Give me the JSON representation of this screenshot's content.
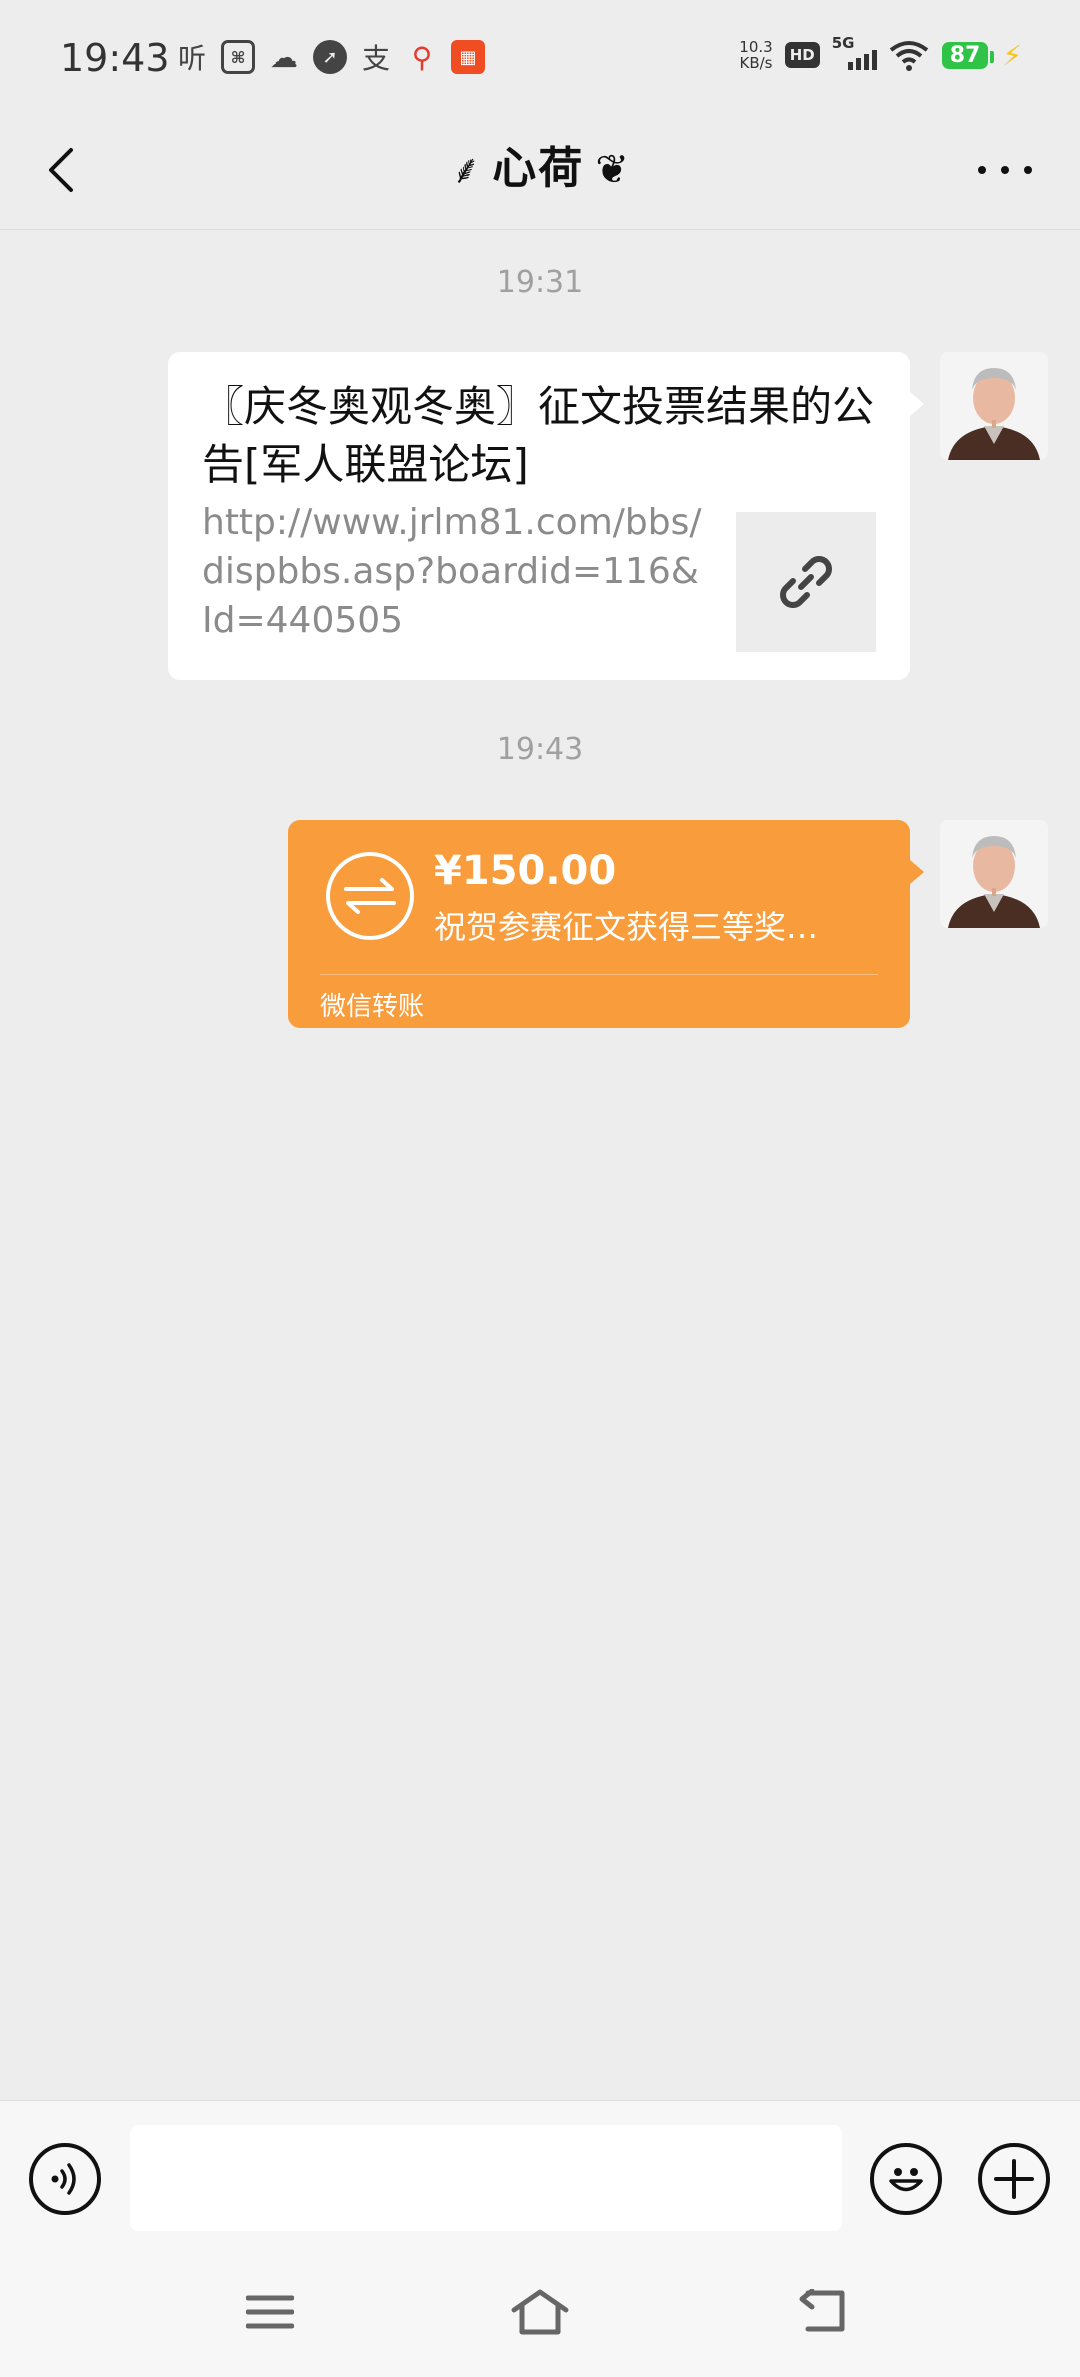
{
  "status_bar": {
    "time": "19:43",
    "net_speed_value": "10.3",
    "net_speed_unit": "KB/s",
    "hd_badge": "HD",
    "network": "5G",
    "battery": "87",
    "left_icons": [
      "listen-icon",
      "sb-app-icon",
      "cloud-icon",
      "compass-icon",
      "alipay-icon",
      "location-pin-icon",
      "app-grid-icon"
    ],
    "listen_glyph": "听",
    "alipay_glyph": "支"
  },
  "header": {
    "title": "心荷",
    "title_ornament_left": "⸙",
    "title_ornament_right": "❦",
    "back_icon": "chevron-left-icon",
    "more_icon": "more-dots-icon"
  },
  "chat": {
    "messages": [
      {
        "timestamp": "19:31",
        "type": "link",
        "title": "〖庆冬奥观冬奥〗征文投票结果的公告[军人联盟论坛]",
        "url": "http://www.jrlm81.com/bbs/dispbbs.asp?boardid=116&Id=440505",
        "thumb_icon": "link-icon"
      },
      {
        "timestamp": "19:43",
        "type": "transfer",
        "amount": "¥150.00",
        "note": "祝贺参赛征文获得三等奖…",
        "label": "微信转账",
        "icon": "transfer-arrows-icon"
      }
    ]
  },
  "input_bar": {
    "placeholder": "",
    "value": "",
    "voice_icon": "voice-icon",
    "emoji_icon": "emoji-icon",
    "plus_icon": "plus-icon"
  },
  "nav_bar": {
    "icons": [
      "menu-icon",
      "home-icon",
      "back-nav-icon"
    ]
  },
  "colors": {
    "background": "#ededed",
    "bubble_white": "#ffffff",
    "transfer_orange": "#f99c3b",
    "battery_green": "#2fc447"
  }
}
